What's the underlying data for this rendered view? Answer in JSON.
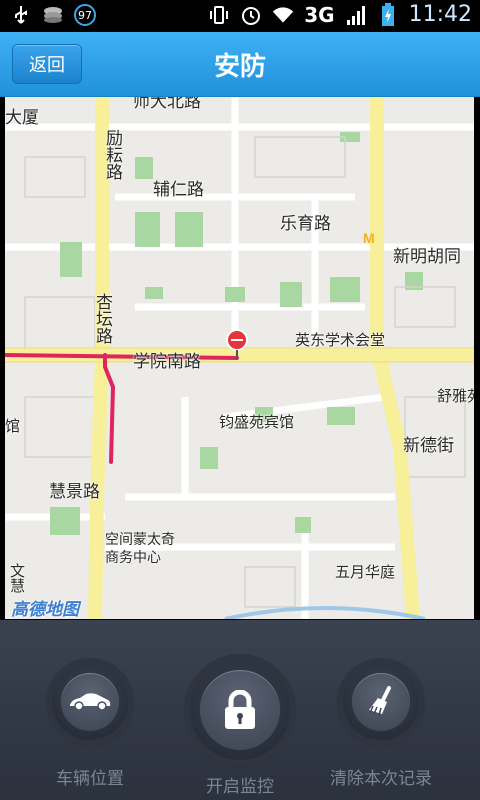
{
  "status_bar": {
    "badge": "97",
    "network": "3G",
    "time": "11:42",
    "icons": [
      "usb-icon",
      "layers-icon",
      "vibrate-icon",
      "alarm-icon",
      "wifi-icon",
      "signal-icon",
      "battery-icon"
    ]
  },
  "header": {
    "back_label": "返回",
    "title": "安防"
  },
  "map": {
    "labels": {
      "top_road": "师大北路",
      "top_left": "大厦",
      "liyuan": "励耘路",
      "furen": "辅仁路",
      "leyu": "乐育路",
      "xinming": "新明胡同",
      "xingtan": "杏坛路",
      "yingdong": "英东学术会堂",
      "xueyuan_south": "学院南路",
      "shuyayuan": "舒雅苑",
      "guan": "馆",
      "junsheng": "钧盛苑宾馆",
      "xinde": "新德街",
      "huijing": "慧景路",
      "kongjian1": "空间蒙太奇",
      "kongjian2": "商务中心",
      "wuyue": "五月华庭",
      "wenhui": "文慧",
      "logo": "高德地图"
    },
    "route_color": "#e0245e",
    "marker_color": "#e8323c"
  },
  "controls": {
    "car_position": "车辆位置",
    "start_monitor": "开启监控",
    "clear_record": "清除本次记录"
  },
  "colors": {
    "header": "#2a9ae4",
    "bottom_panel": "#343a46",
    "road_major": "#f7ef9a"
  }
}
